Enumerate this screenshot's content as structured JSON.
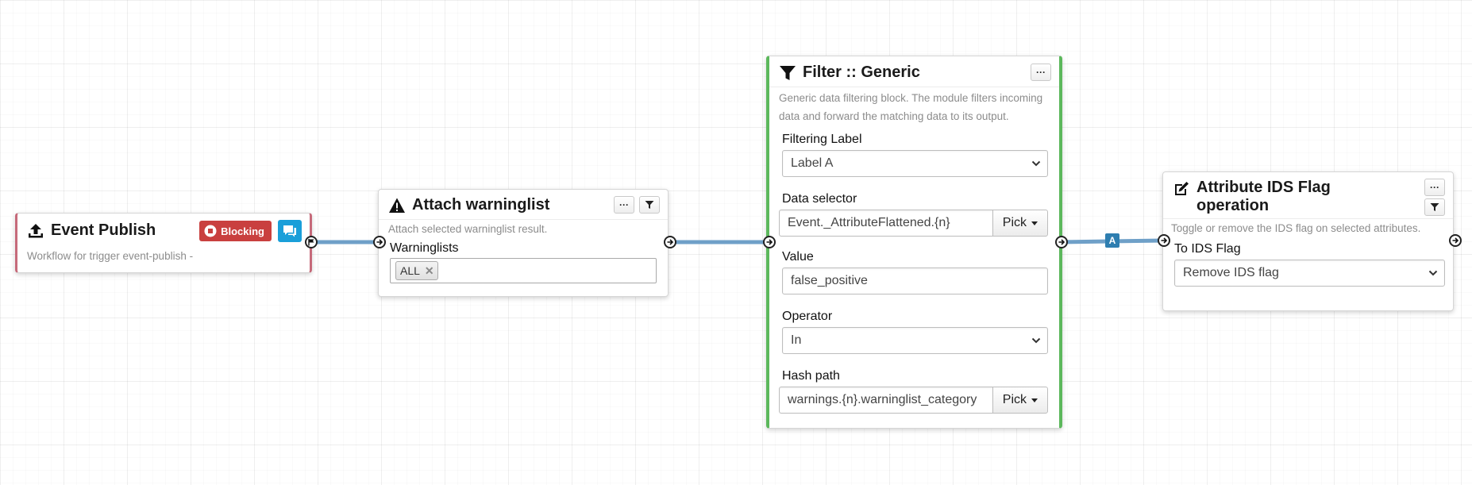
{
  "nodes": {
    "event_publish": {
      "title": "Event Publish",
      "icon": "upload-icon",
      "blocking_label": "Blocking",
      "description": "Workflow for trigger event-publish -"
    },
    "attach_warninglist": {
      "title": "Attach warninglist",
      "icon": "warning-icon",
      "description": "Attach selected warninglist result.",
      "field_label": "Warninglists",
      "chips": [
        "ALL"
      ]
    },
    "filter_generic": {
      "title": "Filter :: Generic",
      "icon": "filter-icon",
      "description": "Generic data filtering block. The module filters incoming data and forward the matching data to its output.",
      "filtering_label": {
        "label": "Filtering Label",
        "value": "Label A"
      },
      "data_selector": {
        "label": "Data selector",
        "value": "Event._AttributeFlattened.{n}",
        "button": "Pick"
      },
      "value": {
        "label": "Value",
        "value": "false_positive"
      },
      "operator": {
        "label": "Operator",
        "value": "In"
      },
      "hash_path": {
        "label": "Hash path",
        "value": "warnings.{n}.warninglist_category",
        "button": "Pick"
      }
    },
    "attribute_ids_flag": {
      "title_line1": "Attribute IDS Flag",
      "title_line2": "operation",
      "icon": "edit-icon",
      "description": "Toggle or remove the IDS flag on selected attributes.",
      "to_ids_flag": {
        "label": "To IDS Flag",
        "value": "Remove IDS flag"
      }
    }
  },
  "connections": [
    {
      "from": "event_publish",
      "to": "attach_warninglist"
    },
    {
      "from": "attach_warninglist",
      "to": "filter_generic"
    },
    {
      "from": "filter_generic",
      "to": "attribute_ids_flag",
      "label": "A"
    }
  ],
  "buttons": {
    "more": "···"
  },
  "colors": {
    "connection": "#6fa0c8",
    "trigger_border": "#c66a7a",
    "filter_border": "#5cb85c",
    "blocking_badge": "#c9403f",
    "chat_button": "#1a9fd9",
    "connection_label": "#2e7eb0"
  }
}
